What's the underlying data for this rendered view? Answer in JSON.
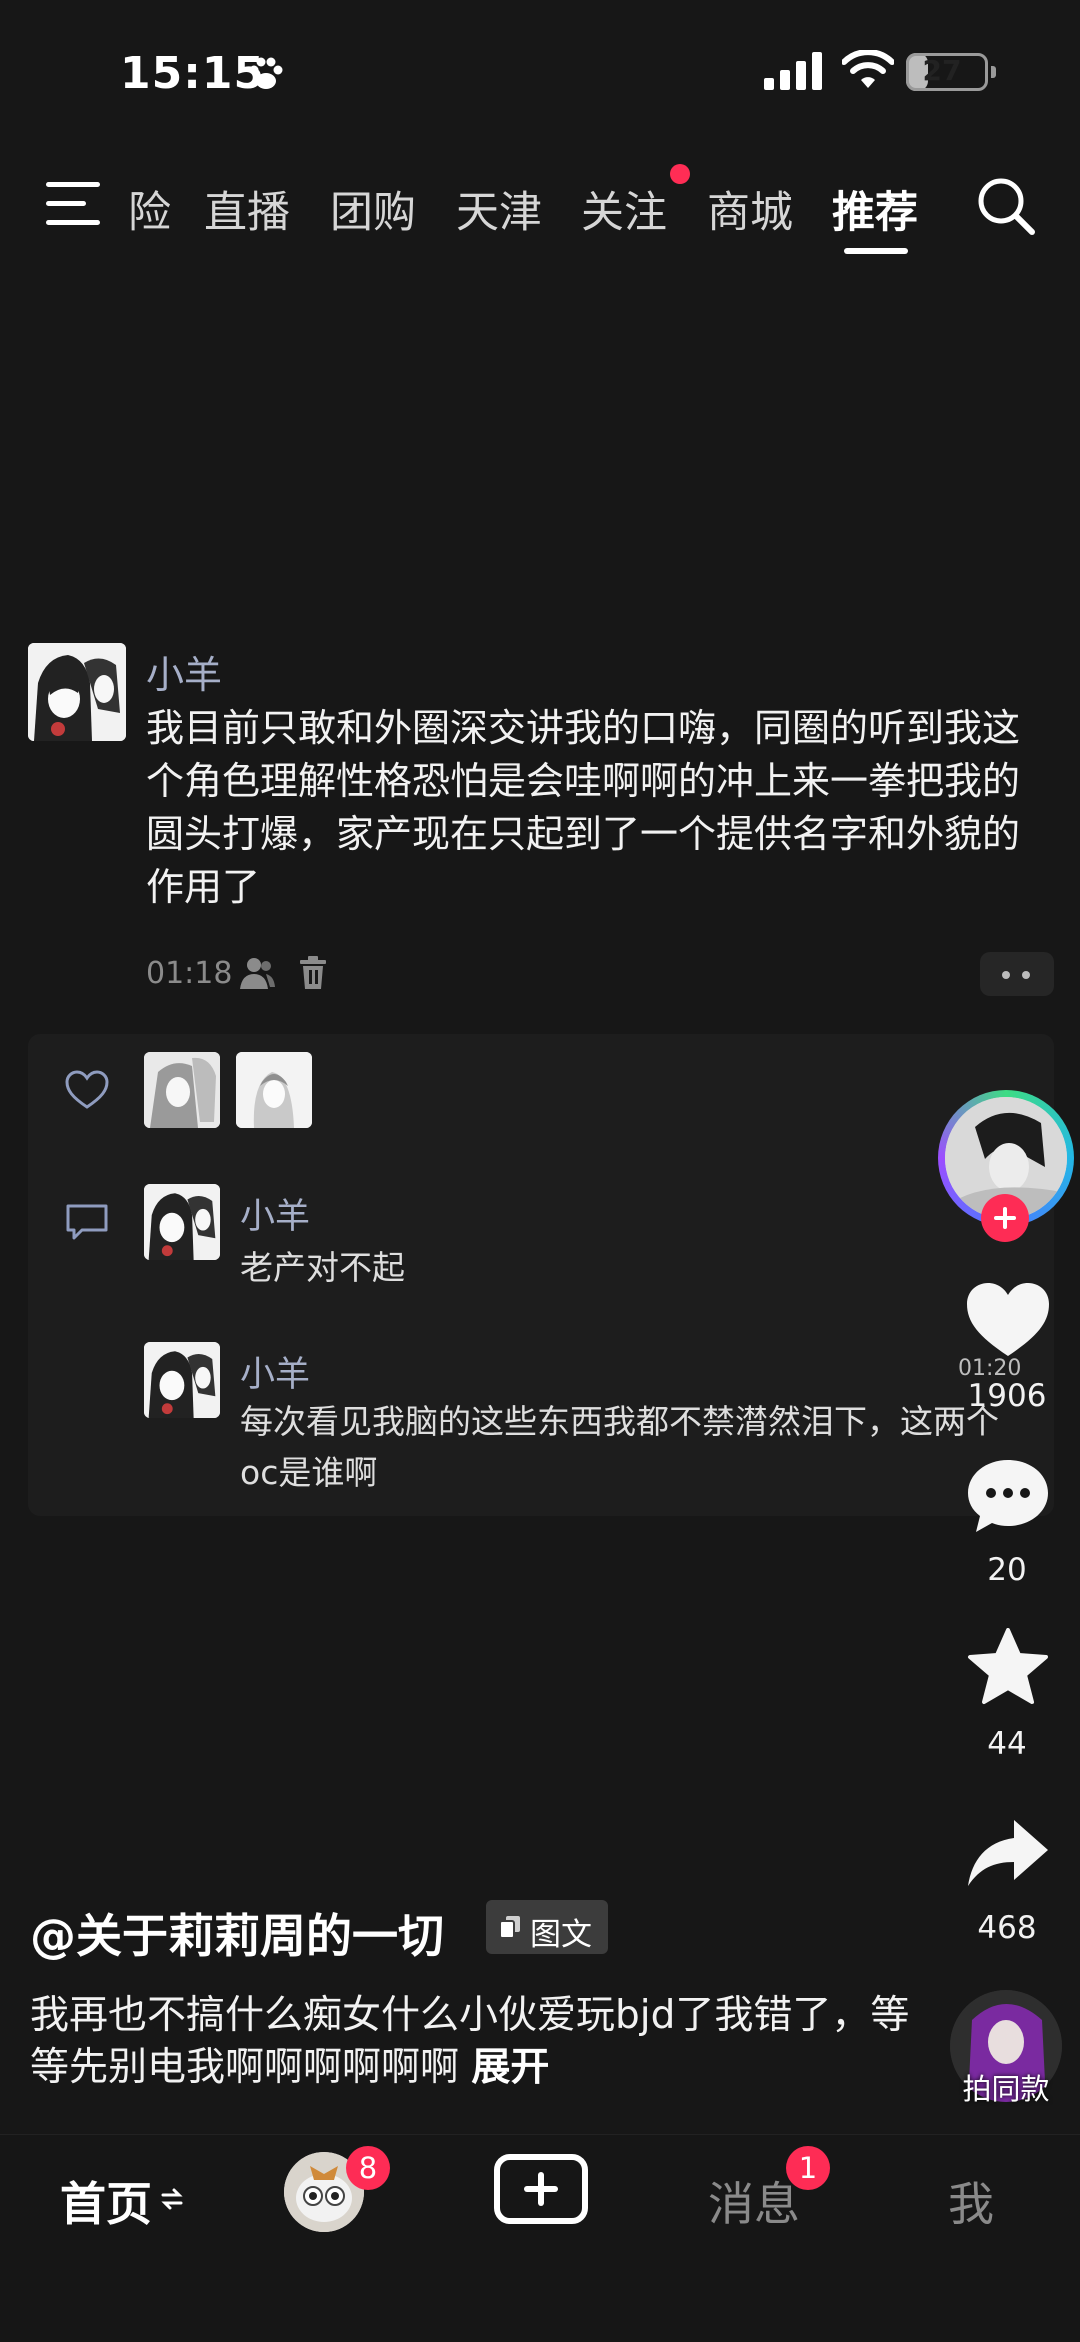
{
  "status_bar": {
    "time": "15:15",
    "battery": "27",
    "battery_fraction": 0.27,
    "icons": [
      "paw-icon",
      "cellular-signal-icon",
      "wifi-icon",
      "battery-icon"
    ]
  },
  "top_nav": {
    "tabs": [
      "险",
      "直播",
      "团购",
      "天津",
      "关注",
      "商城",
      "推荐"
    ],
    "active_tab": "推荐",
    "icons": [
      "menu-icon",
      "search-icon"
    ],
    "accent": "#ff2d55"
  },
  "post": {
    "author": "小羊",
    "text": "我目前只敢和外圈深交讲我的口嗨，同圈的听到我这个角色理解性格恐怕是会哇啊啊的冲上来一拳把我的圆头打爆，家产现在只起到了一个提供名字和外貌的作用了",
    "time": "01:18"
  },
  "comments": [
    {
      "author": "小羊",
      "text": "老产对不起"
    },
    {
      "author": "小羊",
      "text": "每次看见我脑的这些东西我都不禁潸然泪下，这两个oc是谁啊"
    }
  ],
  "rail": {
    "video_time": "01:20",
    "likes": "1906",
    "comments": "20",
    "favorites": "44",
    "shares": "468"
  },
  "caption": {
    "handle": "@关于莉莉周的一切",
    "type_badge": "图文",
    "text": "我再也不搞什么痴女什么小伙爱玩bjd了我错了，等等先别电我啊啊啊啊啊啊",
    "expand": "展开",
    "same_style": "拍同款"
  },
  "bottom_nav": {
    "home": "首页",
    "friends_badge": "8",
    "messages": "消息",
    "messages_badge": "1",
    "me": "我"
  },
  "colors": {
    "background": "#171717",
    "name_blue": "#a6afc8",
    "badge_red": "#fe2c55"
  }
}
